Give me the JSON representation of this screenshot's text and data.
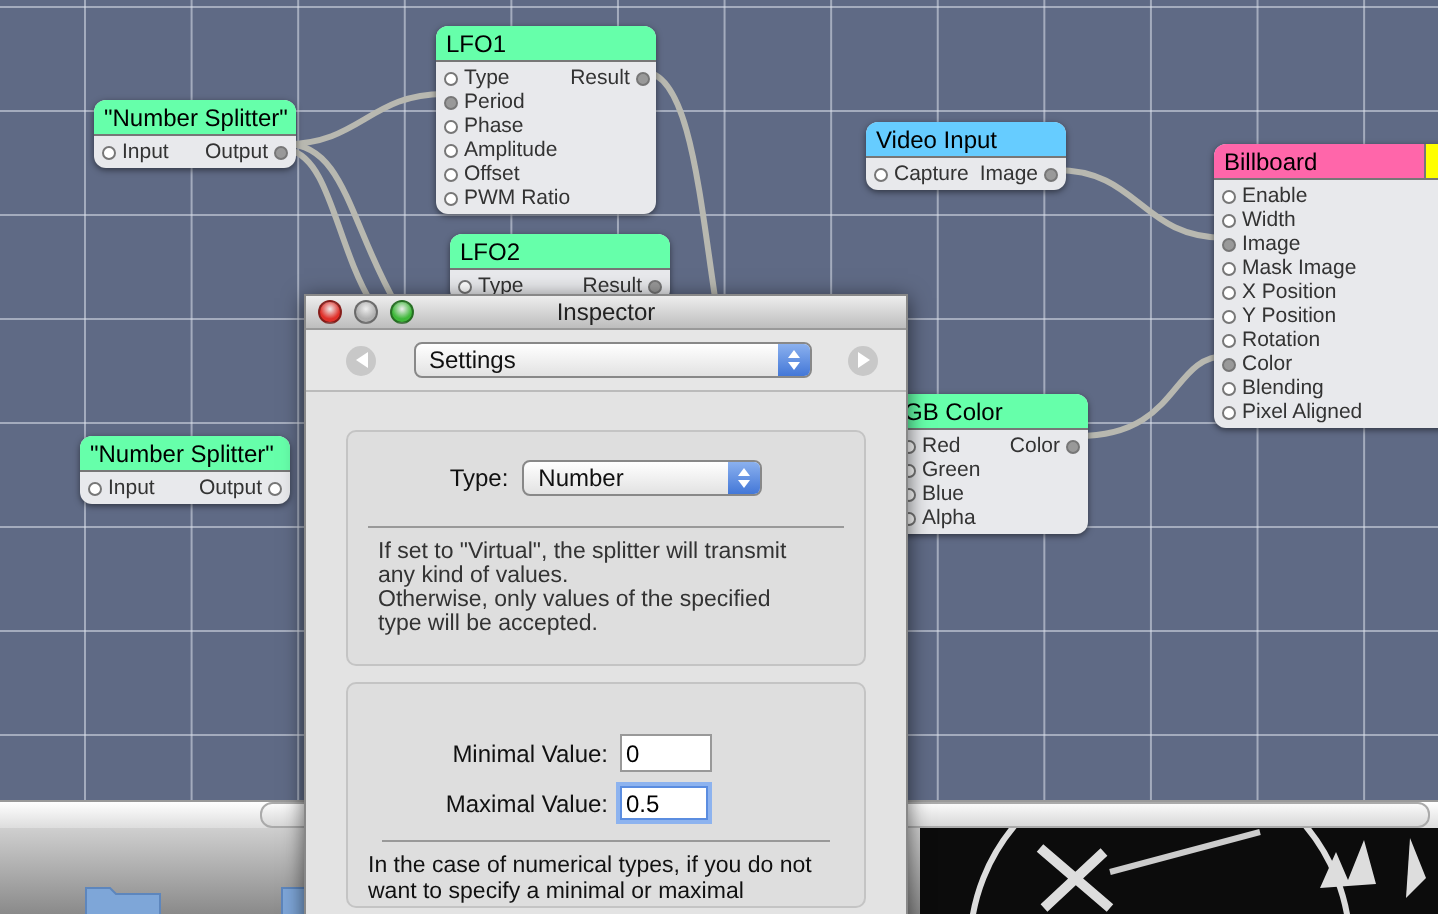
{
  "nodes": [
    {
      "title": "\"Number Splitter\"",
      "color": "#66ffaa",
      "inputs": [
        {
          "label": "Input",
          "connected": false
        }
      ],
      "outputs": [
        {
          "label": "Output",
          "connected": true
        }
      ]
    },
    {
      "title": "LFO1",
      "color": "#66ffaa",
      "inputs": [
        {
          "label": "Type",
          "connected": false
        },
        {
          "label": "Period",
          "connected": true
        },
        {
          "label": "Phase",
          "connected": false
        },
        {
          "label": "Amplitude",
          "connected": false
        },
        {
          "label": "Offset",
          "connected": false
        },
        {
          "label": "PWM Ratio",
          "connected": false
        }
      ],
      "outputs": [
        {
          "label": "Result",
          "connected": true
        }
      ]
    },
    {
      "title": "LFO2",
      "color": "#66ffaa",
      "inputs": [
        {
          "label": "Type",
          "connected": false
        }
      ],
      "outputs": [
        {
          "label": "Result",
          "connected": true
        }
      ]
    },
    {
      "title": "Video Input",
      "color": "#66ccff",
      "inputs": [
        {
          "label": "Capture",
          "connected": false
        }
      ],
      "outputs": [
        {
          "label": "Image",
          "connected": true
        }
      ]
    },
    {
      "title": "Billboard",
      "color": "#ff66aa",
      "tab": {
        "color": "#ffff00"
      },
      "inputs": [
        {
          "label": "Enable",
          "connected": false
        },
        {
          "label": "Width",
          "connected": false
        },
        {
          "label": "Image",
          "connected": true
        },
        {
          "label": "Mask Image",
          "connected": false
        },
        {
          "label": "X Position",
          "connected": false
        },
        {
          "label": "Y Position",
          "connected": false
        },
        {
          "label": "Rotation",
          "connected": false
        },
        {
          "label": "Color",
          "connected": true
        },
        {
          "label": "Blending",
          "connected": false
        },
        {
          "label": "Pixel Aligned",
          "connected": false
        }
      ]
    },
    {
      "title": "\"Number Splitter\"",
      "color": "#66ffaa",
      "inputs": [
        {
          "label": "Input",
          "connected": false
        }
      ],
      "outputs": [
        {
          "label": "Output",
          "connected": false
        }
      ]
    },
    {
      "title": "GB Color",
      "color": "#66ffaa",
      "inputs": [
        {
          "label": "Red",
          "connected": false
        },
        {
          "label": "Green",
          "connected": false
        },
        {
          "label": "Blue",
          "connected": false
        },
        {
          "label": "Alpha",
          "connected": false
        }
      ],
      "outputs": [
        {
          "label": "Color",
          "connected": true
        }
      ]
    }
  ],
  "inspector": {
    "title": "Inspector",
    "section": "Settings",
    "type_label": "Type:",
    "type_value": "Number",
    "description": [
      "If set to \"Virtual\", the splitter will transmit",
      "any kind of values.",
      "Otherwise, only values of the specified",
      "type will be accepted."
    ],
    "fields": [
      {
        "label": "Minimal Value:",
        "value": "0",
        "focused": false
      },
      {
        "label": "Maximal Value:",
        "value": "0.5",
        "focused": true
      }
    ],
    "note": [
      "In the case of numerical types, if you do not",
      "want to specify a minimal or maximal"
    ]
  }
}
